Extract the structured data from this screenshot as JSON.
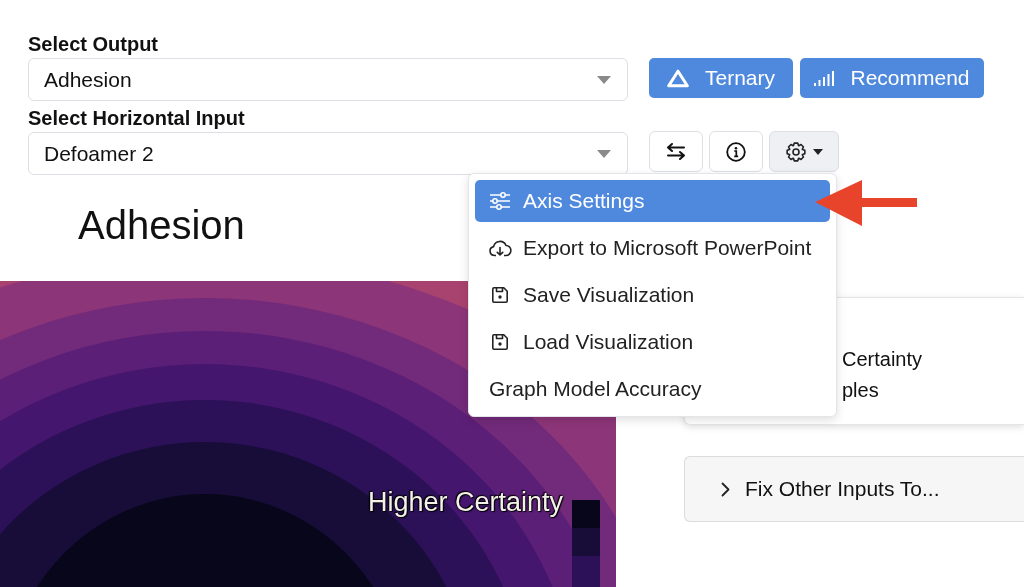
{
  "output_select": {
    "label": "Select Output",
    "value": "Adhesion"
  },
  "input_select": {
    "label": "Select Horizontal Input",
    "value": "Defoamer 2"
  },
  "action_buttons": [
    {
      "kind": "ternary",
      "label": "Ternary"
    },
    {
      "kind": "recommend",
      "label": "Recommend"
    }
  ],
  "toolbar": [
    {
      "kind": "swap"
    },
    {
      "kind": "info"
    },
    {
      "kind": "settings",
      "expanded": true
    }
  ],
  "settings_menu": [
    {
      "kind": "axis",
      "label": "Axis Settings",
      "selected": true
    },
    {
      "kind": "export",
      "label": "Export to Microsoft PowerPoint",
      "selected": false
    },
    {
      "kind": "save",
      "label": "Save Visualization",
      "selected": false
    },
    {
      "kind": "load",
      "label": "Load Visualization",
      "selected": false
    },
    {
      "kind": "plain",
      "label": "Graph Model Accuracy",
      "selected": false
    }
  ],
  "plot": {
    "title": "Adhesion",
    "legend_label": "Higher Certainty"
  },
  "options_card": {
    "lines": [
      "Certainty",
      "ples"
    ]
  },
  "fix_inputs": {
    "label": "Fix Other Inputs To...",
    "expanded": false
  }
}
